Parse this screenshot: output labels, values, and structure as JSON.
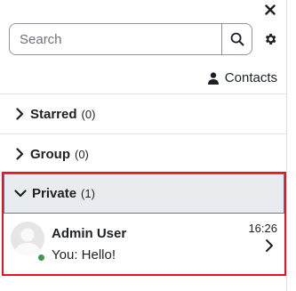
{
  "header": {
    "close_icon": "close-icon"
  },
  "search": {
    "placeholder": "Search",
    "icon": "search-icon"
  },
  "settings": {
    "icon": "gear-icon"
  },
  "contacts": {
    "label": "Contacts",
    "icon": "user-icon"
  },
  "sections": {
    "starred": {
      "title": "Starred",
      "count": "(0)",
      "expanded": false
    },
    "group": {
      "title": "Group",
      "count": "(0)",
      "expanded": false
    },
    "private": {
      "title": "Private",
      "count": "(1)",
      "expanded": true
    }
  },
  "conversations": [
    {
      "name": "Admin User",
      "message": "You: Hello!",
      "time": "16:26",
      "status": "online"
    }
  ],
  "colors": {
    "highlight_border": "#e8151c",
    "section_focus_border": "#4f7fba",
    "online": "#3c9b4e",
    "section_bg": "#e9ecef"
  }
}
